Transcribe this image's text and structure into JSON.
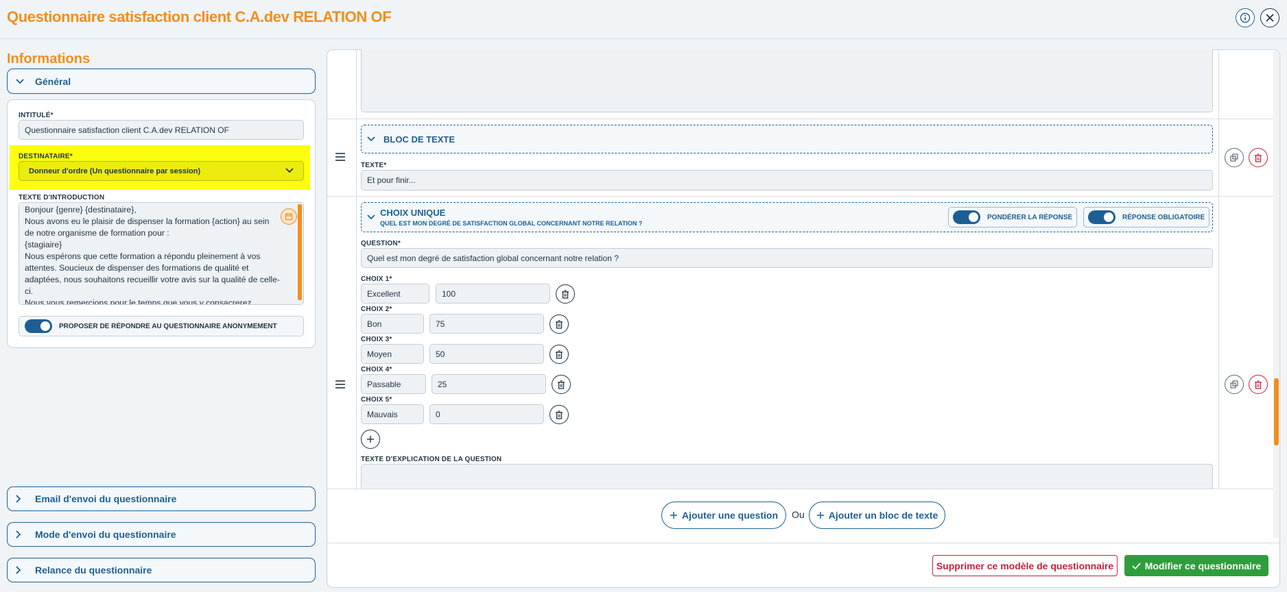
{
  "header": {
    "title": "Questionnaire satisfaction client C.A.dev RELATION OF",
    "info_icon": "info-icon",
    "close_icon": "close-icon"
  },
  "sidebar": {
    "section_title": "Informations",
    "general": {
      "label": "Général",
      "intitule_label": "INTITULÉ*",
      "intitule_value": "Questionnaire satisfaction client C.A.dev RELATION OF",
      "destinataire_label": "DESTINATAIRE*",
      "destinataire_value": "Donneur d'ordre (Un questionnaire par session)",
      "intro_label": "TEXTE D'INTRODUCTION",
      "intro_text": "Bonjour {genre} {destinataire},\nNous avons eu le plaisir de dispenser la formation {action} au sein de notre organisme de formation pour :\n{stagiaire}\nNous espérons que cette formation a répondu pleinement à vos attentes. Soucieux de dispenser des formations de qualité et adaptées, nous souhaitons recueillir votre avis sur la qualité de celle-ci.\nNous vous remercions pour le temps que vous y consacrerez.",
      "anon_label": "PROPOSER DE RÉPONDRE AU QUESTIONNAIRE ANONYMEMENT",
      "anon_on": true
    },
    "collapsed": [
      "Email d'envoi du questionnaire",
      "Mode d'envoi du questionnaire",
      "Relance du questionnaire"
    ]
  },
  "main": {
    "text_block": {
      "title": "BLOC DE TEXTE",
      "texte_label": "TEXTE*",
      "texte_value": "Et pour finir..."
    },
    "choice_block": {
      "title": "CHOIX UNIQUE",
      "subtitle": "QUEL EST MON DEGRÉ DE SATISFACTION GLOBAL CONCERNANT NOTRE RELATION ?",
      "ponderer_label": "PONDÉRER LA RÉPONSE",
      "obligatoire_label": "RÉPONSE OBLIGATOIRE",
      "question_label": "QUESTION*",
      "question_value": "Quel est mon degré de satisfaction global concernant notre relation ?",
      "choices": [
        {
          "label": "CHOIX 1*",
          "text": "Excellent",
          "score": "100"
        },
        {
          "label": "CHOIX 2*",
          "text": "Bon",
          "score": "75"
        },
        {
          "label": "CHOIX 3*",
          "text": "Moyen",
          "score": "50"
        },
        {
          "label": "CHOIX 4*",
          "text": "Passable",
          "score": "25"
        },
        {
          "label": "CHOIX 5*",
          "text": "Mauvais",
          "score": "0"
        }
      ],
      "explication_label": "TEXTE D'EXPLICATION DE LA QUESTION"
    },
    "add_question": "Ajouter une question",
    "or_label": "Ou",
    "add_text_block": "Ajouter un bloc de texte"
  },
  "footer": {
    "delete_label": "Supprimer ce modèle de questionnaire",
    "save_label": "Modifier ce questionnaire"
  },
  "colors": {
    "accent_orange": "#f28e1c",
    "primary_blue": "#1d5f94",
    "highlight": "#fdfd0e",
    "danger": "#c4243a",
    "success": "#2e9e3c"
  }
}
